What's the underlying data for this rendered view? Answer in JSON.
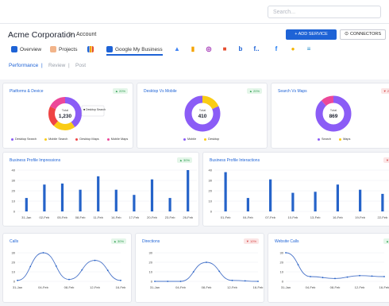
{
  "search": {
    "placeholder": "Search..."
  },
  "header": {
    "company": "Acme Corporation",
    "breadcrumb_sep": ">",
    "breadcrumb": "Account",
    "add_service": "+ ADD SERVICE",
    "connectors": "CONNECTORS"
  },
  "tabs": [
    {
      "label": "Overview",
      "icon": "grid-icon"
    },
    {
      "label": "Projects",
      "icon": "folder-icon"
    },
    {
      "label": "",
      "icon": "bar-chart-icon"
    },
    {
      "label": "Google My Business",
      "icon": "google-my-business-icon"
    }
  ],
  "sources": [
    {
      "icon": "google-ads-icon",
      "glyph": "▲",
      "color": "#4285f4"
    },
    {
      "icon": "google-analytics-icon",
      "glyph": "▮",
      "color": "#f4a300"
    },
    {
      "icon": "search-console-icon",
      "glyph": "◎",
      "color": "#9c27b0"
    },
    {
      "icon": "microsoft-icon",
      "glyph": "■",
      "color": "#e54d2e"
    },
    {
      "icon": "bing-icon",
      "glyph": "b",
      "color": "#1e63d6"
    },
    {
      "icon": "facebook-ads-icon",
      "glyph": "f..",
      "color": "#1e63d6"
    },
    {
      "icon": "facebook-icon",
      "glyph": "f",
      "color": "#1877f2"
    },
    {
      "icon": "google-sheets-icon",
      "glyph": "●",
      "color": "#f4b400"
    },
    {
      "icon": "list-icon",
      "glyph": "≡",
      "color": "#1e88c9"
    }
  ],
  "subnav": {
    "performance": "Performance",
    "review": "Review",
    "post": "Post",
    "sep": "|"
  },
  "colors": {
    "primary": "#1e63d6",
    "purple": "#8b5cf6",
    "pink": "#ec4899",
    "yellow": "#facc15",
    "red": "#ef4444",
    "bar": "#2563c9"
  },
  "cards": {
    "platforms": {
      "title": "Platforms & Device",
      "badge": "▲ 20%",
      "total_label": "Total",
      "total": "1,230",
      "tooltip": "■ Desktop Search",
      "legend": [
        "Desktop Search",
        "Mobile Search",
        "Desktop Maps",
        "Mobile Maps"
      ]
    },
    "desktop_mobile": {
      "title": "Desktop Vs Mobile",
      "badge": "▲ 20%",
      "total_label": "Total",
      "total": "410",
      "legend": [
        "Mobile",
        "Desktop"
      ]
    },
    "search_maps": {
      "title": "Search Vs Maps",
      "badge": "▼ 2",
      "total_label": "Total",
      "total": "869",
      "legend": [
        "Search",
        "Maps"
      ]
    },
    "impressions": {
      "title": "Business Profile Impressions",
      "badge": "▲ 30%"
    },
    "interactions": {
      "title": "Business Profile Interactions",
      "badge": "▼"
    },
    "calls": {
      "title": "Calls",
      "badge": "▲ 30%"
    },
    "directions": {
      "title": "Directions",
      "badge": "▼ 10%"
    },
    "website_calls": {
      "title": "Website Calls",
      "badge": "▲"
    }
  },
  "chart_data": [
    {
      "type": "pie",
      "title": "Platforms & Device",
      "categories": [
        "Desktop Search",
        "Mobile Search",
        "Desktop Maps",
        "Mobile Maps"
      ],
      "values": [
        40,
        22,
        20,
        18
      ],
      "colors": [
        "#8b5cf6",
        "#facc15",
        "#ef4444",
        "#ec4899"
      ],
      "center_label": "1,230"
    },
    {
      "type": "pie",
      "title": "Desktop Vs Mobile",
      "categories": [
        "Mobile",
        "Desktop"
      ],
      "values": [
        18,
        82
      ],
      "colors": [
        "#facc15",
        "#8b5cf6"
      ],
      "center_label": "410"
    },
    {
      "type": "pie",
      "title": "Search Vs Maps",
      "categories": [
        "Search",
        "Maps"
      ],
      "values": [
        88,
        12
      ],
      "colors": [
        "#8b5cf6",
        "#ec4899"
      ],
      "center_label": "869"
    },
    {
      "type": "bar",
      "title": "Business Profile Impressions",
      "categories": [
        "31-Jan",
        "02-Feb",
        "05-Feb",
        "08-Feb",
        "11-Feb",
        "14-Feb",
        "17-Feb",
        "20-Feb",
        "23-Feb",
        "26-Feb"
      ],
      "values": [
        13,
        26,
        27,
        21,
        34,
        21,
        16,
        31,
        13,
        40
      ],
      "ylim": [
        0,
        40
      ],
      "yticks": [
        0,
        10,
        20,
        30,
        40
      ]
    },
    {
      "type": "bar",
      "title": "Business Profile Interactions",
      "categories": [
        "01-Feb",
        "04-Feb",
        "07-Feb",
        "10-Feb",
        "13-Feb",
        "16-Feb",
        "19-Feb",
        "22-Feb"
      ],
      "values": [
        38,
        13,
        31,
        18,
        19,
        26,
        21,
        17
      ],
      "ylim": [
        0,
        40
      ],
      "yticks": [
        0,
        10,
        20,
        30,
        40
      ]
    },
    {
      "type": "line",
      "title": "Calls",
      "x": [
        "31-Jan",
        "04-Feb",
        "08-Feb",
        "12-Feb",
        "16-Feb"
      ],
      "y": [
        1,
        30,
        2,
        22,
        1
      ],
      "ylim": [
        0,
        30
      ],
      "yticks": [
        0,
        10,
        20,
        30
      ]
    },
    {
      "type": "line",
      "title": "Directions",
      "x": [
        "31-Jan",
        "04-Feb",
        "08-Feb",
        "12-Feb",
        "16-Feb"
      ],
      "y": [
        0,
        0,
        20,
        1,
        0
      ],
      "ylim": [
        0,
        30
      ],
      "yticks": [
        0,
        10,
        20,
        30
      ]
    },
    {
      "type": "line",
      "title": "Website Calls",
      "x": [
        "31-Jan",
        "04-Feb",
        "08-Feb",
        "12-Feb",
        "16-Feb"
      ],
      "y": [
        30,
        5,
        3,
        6,
        5
      ],
      "ylim": [
        0,
        30
      ],
      "yticks": [
        0,
        10,
        20,
        30
      ]
    }
  ]
}
